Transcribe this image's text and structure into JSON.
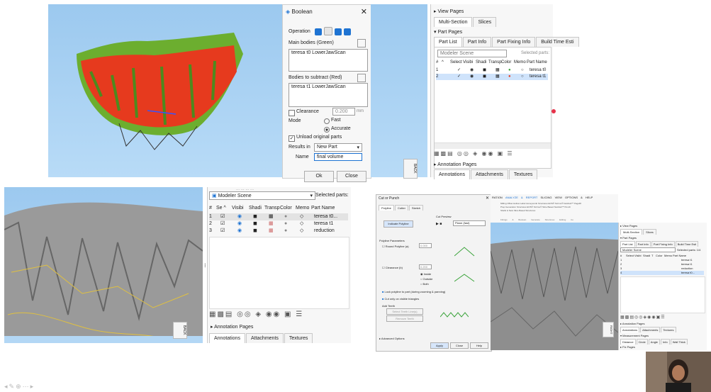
{
  "boolean_dialog": {
    "title": "Boolean",
    "operation_label": "Operation",
    "main_bodies_label": "Main bodies (Green)",
    "main_body_item": "teresa t0 LowerJawScan",
    "subtract_label": "Bodies to subtract (Red)",
    "subtract_item": "teresa t1 LowerJawScan",
    "clearance_label": "Clearance",
    "clearance_value": "0.200",
    "clearance_unit": "mm",
    "mode_label": "Mode",
    "mode_fast": "Fast",
    "mode_accurate": "Accurate",
    "unload_label": "Unload original parts",
    "results_label": "Results in",
    "results_value": "New Part",
    "name_label": "Name",
    "name_value": "final volume",
    "ok": "Ok",
    "close": "Close"
  },
  "top_right_panel": {
    "view_pages": "View Pages",
    "tab_multi": "Multi-Section",
    "tab_slices": "Slices",
    "part_pages": "Part Pages",
    "subtabs": [
      "Part List",
      "Part Info",
      "Part Fixing Info",
      "Build Time Esti"
    ],
    "scene": "Modeler Scene",
    "selected_parts": "Selected parts:",
    "columns": [
      "#",
      "^",
      "Select",
      "Visibi",
      "Shadi",
      "Transp",
      "Color",
      "Memo",
      "Part Name"
    ],
    "rows": [
      {
        "num": "1",
        "name": "teresa t0"
      },
      {
        "num": "2",
        "name": "teresa t1"
      }
    ],
    "annotation_pages": "Annotation Pages",
    "bottom_tabs": [
      "Annotations",
      "Attachments",
      "Textures"
    ]
  },
  "bottom_mid_panel": {
    "top_clipped": "... ... ... ...",
    "scene": "Modeler Scene",
    "selected_parts": "Selected parts:",
    "columns": [
      "#",
      "Se ^",
      "Visibi",
      "Shadi",
      "Transp",
      "Color",
      "Memo",
      "Part Name"
    ],
    "rows": [
      {
        "num": "1",
        "name": "teresa t0..."
      },
      {
        "num": "2",
        "name": "teresa t1"
      },
      {
        "num": "3",
        "name": "reduction"
      }
    ],
    "annotation_pages": "Annotation Pages",
    "bottom_tabs": [
      "Annotations",
      "Attachments",
      "Textures"
    ]
  },
  "cut_dialog": {
    "title": "Cut or Punch",
    "tabs": [
      "Polyline",
      "Cutter",
      "Sketch"
    ],
    "indicate_polyline": "Indicate Polyline",
    "cut_preview": "Cut Preview",
    "plane_label": "Plane (fast)",
    "polyline_params": "Polyline Parameters",
    "round_polyline": "Round Polyline (a)",
    "round_value": "0.000",
    "clearance": "Clearance (b)",
    "clearance_value": "0.200",
    "inside": "Inside",
    "outside": "Outside",
    "both": "Both",
    "lock_polyline": "Lock polyline to part (during zooming & panning)",
    "cut_visible": "Cut only on visible triangles",
    "add_teeth": "Add Teeth",
    "select_teeth": "Select Teeth Line(s)",
    "remove_teeth": "Remove Teeth",
    "advanced": "Advanced Options",
    "apply": "Apply",
    "close": "Close",
    "help": "Help"
  },
  "ribbon": {
    "items": [
      "RATION",
      "ANALYZE & REPORT",
      "SLICING",
      "VIEW",
      "OPTIONS & HELP"
    ],
    "tools": [
      "Milling Offset",
      "Hollow",
      "Label",
      "Honeycomb Structures",
      "EOS® Scrimo® Netshell™",
      "Pagelift",
      "Prep Generation",
      "Structures",
      "EOS® Scrimo® Slice Based Netshell™",
      "Punch",
      "Shells & Nets",
      "Slice Based Structures"
    ],
    "groups": [
      "Fittings & Boolean",
      "Generate",
      "Structures",
      "Editing",
      "Co"
    ]
  },
  "bottom_right_panel": {
    "view_pages": "View Pages",
    "tab_multi": "Multi-Section",
    "tab_slices": "Slices",
    "part_pages": "Part Pages",
    "subtabs": [
      "Part List",
      "Part Info",
      "Part Fixing Info",
      "Build Time Esti"
    ],
    "scene": "Modeler Scene",
    "selected_parts": "Selected parts: 1/4",
    "columns": [
      "#",
      "Select",
      "Visibi",
      "Shadi",
      "T",
      "Color",
      "Memo",
      "Part Name"
    ],
    "rows": [
      {
        "num": "1",
        "name": "teresa t1"
      },
      {
        "num": "2",
        "name": "teresa t1"
      },
      {
        "num": "3",
        "name": "reduction"
      },
      {
        "num": "4",
        "name": "teresa t0..."
      }
    ],
    "annotation_pages": "Annotation Pages",
    "bottom_tabs": [
      "Annotations",
      "Attachments",
      "Textures"
    ],
    "measurement": "Measurement Pages",
    "meas_tabs": [
      "Distance",
      "Circle",
      "Angle",
      "Info",
      "Wall Thick"
    ],
    "fix_pages": "Fix Pages"
  },
  "cube_label": "BACK",
  "cube_label2": "RIGHT",
  "colors": {
    "viewport_blue": "#a9d3f5",
    "red_mesh": "#e63a1e",
    "green_mesh": "#6cae2f",
    "gray_mesh": "#9a9a9a",
    "selection": "#1e73d2"
  }
}
